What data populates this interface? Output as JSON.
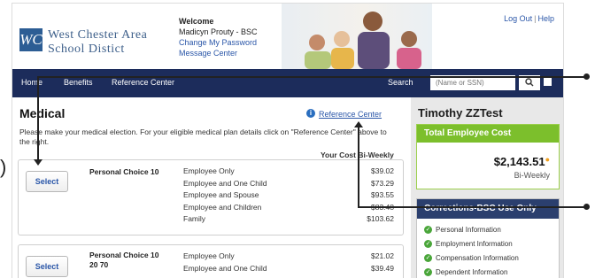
{
  "header": {
    "logo_mark": "WC",
    "logo_line1": "West Chester Area",
    "logo_line2": "School Distict",
    "welcome_title": "Welcome",
    "user_name": "Madicyn Prouty - BSC",
    "change_password": "Change My Password",
    "message_center": "Message Center",
    "log_out": "Log Out",
    "link_separator": "|",
    "help": "Help"
  },
  "nav": {
    "items": [
      "Home",
      "Benefits",
      "Reference Center"
    ],
    "search_label": "Search",
    "search_placeholder": "(Name or SSN)"
  },
  "main": {
    "title": "Medical",
    "reference_link": "Reference Center",
    "instructions": "Please make your medical election. For your eligible medical plan details click on \"Reference Center\" above to the right.",
    "cost_header": "Your Cost Bi-Weekly",
    "plans": [
      {
        "select_label": "Select",
        "name": "Personal Choice 10",
        "coverages": [
          "Employee Only",
          "Employee and One Child",
          "Employee and Spouse",
          "Employee and Children",
          "Family"
        ],
        "costs": [
          "$39.02",
          "$73.29",
          "$93.55",
          "$83.48",
          "$103.62"
        ]
      },
      {
        "select_label": "Select",
        "name": "Personal Choice 10 20 70",
        "coverages": [
          "Employee Only",
          "Employee and One Child"
        ],
        "costs": [
          "$21.02",
          "$39.49"
        ]
      }
    ]
  },
  "sidebar": {
    "employee_name": "Timothy ZZTest",
    "total_cost_label": "Total Employee Cost",
    "total_cost_value": "$2,143.51",
    "total_cost_period": "Bi-Weekly",
    "corrections_title": "Corrections-BSC Use Only",
    "corrections_items": [
      "Personal Information",
      "Employment Information",
      "Compensation Information",
      "Dependent Information"
    ]
  },
  "colors": {
    "nav_bg": "#1c2c5b",
    "link": "#2a56a8",
    "total_cost_header": "#7cbf2c",
    "corrections_header": "#2b3f6e"
  }
}
